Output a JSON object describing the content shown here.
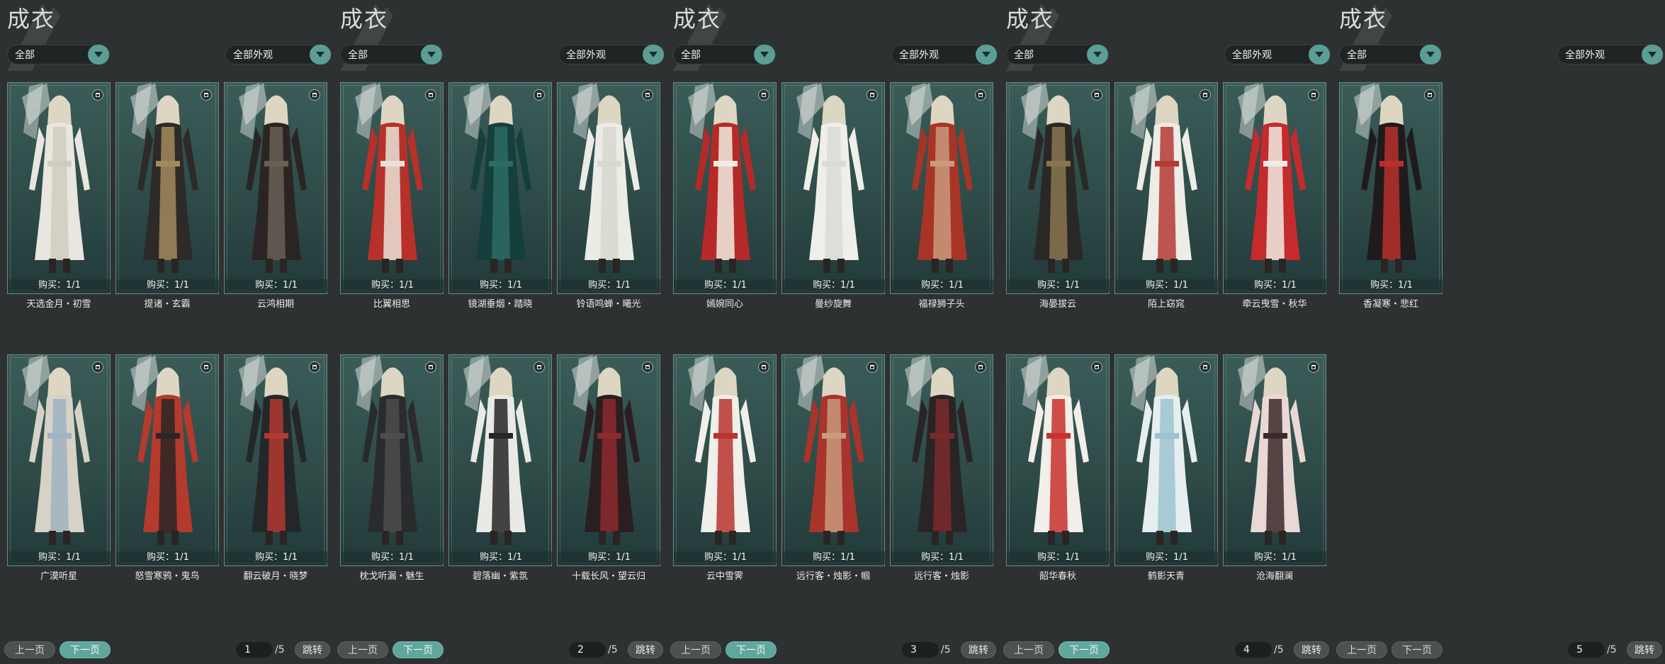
{
  "pages": [
    {
      "title": "成衣",
      "filter_left": "全部",
      "filter_right": "全部外观",
      "items": [
        {
          "name": "天选金月・初雪",
          "buy": "购买：1/1",
          "colors": [
            "#e8e6df",
            "#cfcbbf"
          ]
        },
        {
          "name": "提诸・玄霸",
          "buy": "购买：1/1",
          "colors": [
            "#2d2a27",
            "#a38a5e"
          ]
        },
        {
          "name": "云鸿相期",
          "buy": "购买：1/1",
          "colors": [
            "#2a2523",
            "#6a5f55"
          ]
        },
        {
          "name": "广漠听星",
          "buy": "购买：1/1",
          "colors": [
            "#d6d3c6",
            "#9fb3c2"
          ]
        },
        {
          "name": "怒雪寒鸦・鬼鸟",
          "buy": "购买：1/1",
          "colors": [
            "#b43a2e",
            "#2b2625"
          ]
        },
        {
          "name": "翻云破月・晓梦",
          "buy": "购买：1/1",
          "colors": [
            "#24272a",
            "#b13a30"
          ]
        }
      ],
      "nav": {
        "prev": "上一页",
        "next": "下一页",
        "current": "1",
        "total": "/5",
        "jump": "跳转",
        "next_active": true
      }
    },
    {
      "title": "成衣",
      "filter_left": "全部",
      "filter_right": "全部外观",
      "items": [
        {
          "name": "比翼相思",
          "buy": "购买：1/1",
          "colors": [
            "#b8302a",
            "#e8e2d6"
          ]
        },
        {
          "name": "镜湖垂烟・踏晓",
          "buy": "购买：1/1",
          "colors": [
            "#153f3c",
            "#2d6b63"
          ]
        },
        {
          "name": "铃语鸣蝉・曦光",
          "buy": "购买：1/1",
          "colors": [
            "#ecece6",
            "#d7d8cf"
          ]
        },
        {
          "name": "枕戈听漏・魅生",
          "buy": "购买：1/1",
          "colors": [
            "#2a2b2c",
            "#4b4d4e"
          ]
        },
        {
          "name": "碧落幽・紫氛",
          "buy": "购买：1/1",
          "colors": [
            "#e9eae6",
            "#262626"
          ]
        },
        {
          "name": "十载长风・望云归",
          "buy": "购买：1/1",
          "colors": [
            "#2a1e20",
            "#8c2a2e"
          ]
        }
      ],
      "nav": {
        "prev": "上一页",
        "next": "下一页",
        "current": "2",
        "total": "/5",
        "jump": "跳转",
        "next_active": true
      }
    },
    {
      "title": "成衣",
      "filter_left": "全部",
      "filter_right": "全部外观",
      "items": [
        {
          "name": "嫣婉同心",
          "buy": "购买：1/1",
          "colors": [
            "#b52a28",
            "#f1ece2"
          ]
        },
        {
          "name": "曼纱旋舞",
          "buy": "购买：1/1",
          "colors": [
            "#efefea",
            "#d9dbd6"
          ]
        },
        {
          "name": "福禄狮子头",
          "buy": "购买：1/1",
          "colors": [
            "#a83428",
            "#c99a7c"
          ]
        },
        {
          "name": "云中雪霁",
          "buy": "购买：1/1",
          "colors": [
            "#f0efe9",
            "#b8342e"
          ]
        },
        {
          "name": "远行客・烛影・帼",
          "buy": "购买：1/1",
          "colors": [
            "#a9342b",
            "#c99a7c"
          ]
        },
        {
          "name": "远行客・烛影",
          "buy": "购买：1/1",
          "colors": [
            "#2a2425",
            "#7a2a2d"
          ]
        }
      ],
      "nav": {
        "prev": "上一页",
        "next": "下一页",
        "current": "3",
        "total": "/5",
        "jump": "跳转",
        "next_active": true
      }
    },
    {
      "title": "成衣",
      "filter_left": "全部",
      "filter_right": "全部外观",
      "items": [
        {
          "name": "海晏拔云",
          "buy": "购买：1/1",
          "colors": [
            "#2a2826",
            "#8a7550"
          ]
        },
        {
          "name": "陌上窈窕",
          "buy": "购买：1/1",
          "colors": [
            "#eeece6",
            "#b43a34"
          ]
        },
        {
          "name": "牵云曳雪・秋华",
          "buy": "购买：1/1",
          "colors": [
            "#c52a2c",
            "#f0ebe4"
          ]
        },
        {
          "name": "韶华春秋",
          "buy": "购买：1/1",
          "colors": [
            "#f2eee8",
            "#c8302d"
          ]
        },
        {
          "name": "鹤影天青",
          "buy": "购买：1/1",
          "colors": [
            "#e6eef0",
            "#9cc3cf"
          ]
        },
        {
          "name": "沧海翻澜",
          "buy": "购买：1/1",
          "colors": [
            "#e9d8d4",
            "#3a2a2a"
          ]
        }
      ],
      "nav": {
        "prev": "上一页",
        "next": "下一页",
        "current": "4",
        "total": "/5",
        "jump": "跳转",
        "next_active": true
      }
    },
    {
      "title": "成衣",
      "filter_left": "全部",
      "filter_right": "全部外观",
      "items": [
        {
          "name": "香凝寒・悲红",
          "buy": "购买：1/1",
          "colors": [
            "#1f1b1c",
            "#b8302e"
          ]
        }
      ],
      "nav": {
        "prev": "上一页",
        "next": "下一页",
        "current": "5",
        "total": "/5",
        "jump": "跳转",
        "next_active": false
      }
    }
  ]
}
